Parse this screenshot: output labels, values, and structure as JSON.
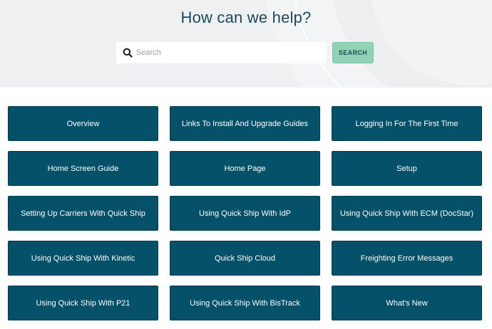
{
  "hero": {
    "title": "How can we help?"
  },
  "search": {
    "placeholder": "Search",
    "value": "",
    "icon": "search-icon",
    "button_label": "SEARCH"
  },
  "colors": {
    "hero_background": "#eef0f2",
    "title": "#1b4a5e",
    "card_background": "#05516a",
    "card_text": "#ffffff",
    "search_button": "#8fd2b4"
  },
  "categories": [
    {
      "label": "Overview"
    },
    {
      "label": "Links To Install And Upgrade Guides"
    },
    {
      "label": "Logging In For The First Time"
    },
    {
      "label": "Home Screen Guide"
    },
    {
      "label": "Home Page"
    },
    {
      "label": "Setup"
    },
    {
      "label": "Setting Up Carriers With Quick Ship"
    },
    {
      "label": "Using Quick Ship With IdP"
    },
    {
      "label": "Using Quick Ship With ECM (DocStar)"
    },
    {
      "label": "Using Quick Ship With Kinetic"
    },
    {
      "label": "Quick Ship Cloud"
    },
    {
      "label": "Freighting Error Messages"
    },
    {
      "label": "Using Quick Ship With P21"
    },
    {
      "label": "Using Quick Ship With BisTrack"
    },
    {
      "label": "What's New"
    }
  ]
}
